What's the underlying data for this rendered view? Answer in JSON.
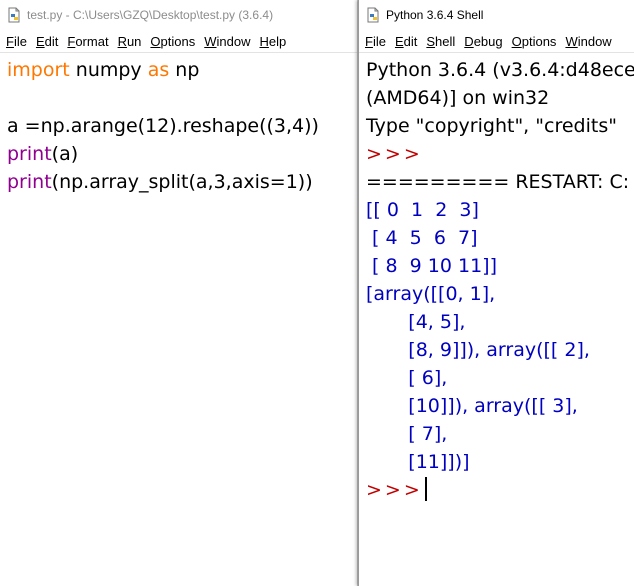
{
  "editor": {
    "title": "test.py - C:\\Users\\GZQ\\Desktop\\test.py (3.6.4)",
    "menu": [
      "File",
      "Edit",
      "Format",
      "Run",
      "Options",
      "Window",
      "Help"
    ],
    "code": {
      "line1_kw1": "import",
      "line1_mid": " numpy ",
      "line1_kw2": "as",
      "line1_end": " np",
      "line3": "a =np.arange(12).reshape((3,4))",
      "line4_fn": "print",
      "line4_rest": "(a)",
      "line5_fn": "print",
      "line5_rest": "(np.array_split(a,3,axis=1))"
    }
  },
  "shell": {
    "title": "Python 3.6.4 Shell",
    "menu": [
      "File",
      "Edit",
      "Shell",
      "Debug",
      "Options",
      "Window"
    ],
    "banner": [
      "Python 3.6.4 (v3.6.4:d48ece",
      "(AMD64)] on win32",
      "Type \"copyright\", \"credits\""
    ],
    "prompt": ">>>",
    "restart": "========= RESTART: C:",
    "output": [
      "[[ 0  1  2  3]",
      " [ 4  5  6  7]",
      " [ 8  9 10 11]]",
      "[array([[0, 1],",
      "       [4, 5],",
      "       [8, 9]]), array([[ 2],",
      "       [ 6],",
      "       [10]]), array([[ 3],",
      "       [ 7],",
      "       [11]])]"
    ]
  }
}
